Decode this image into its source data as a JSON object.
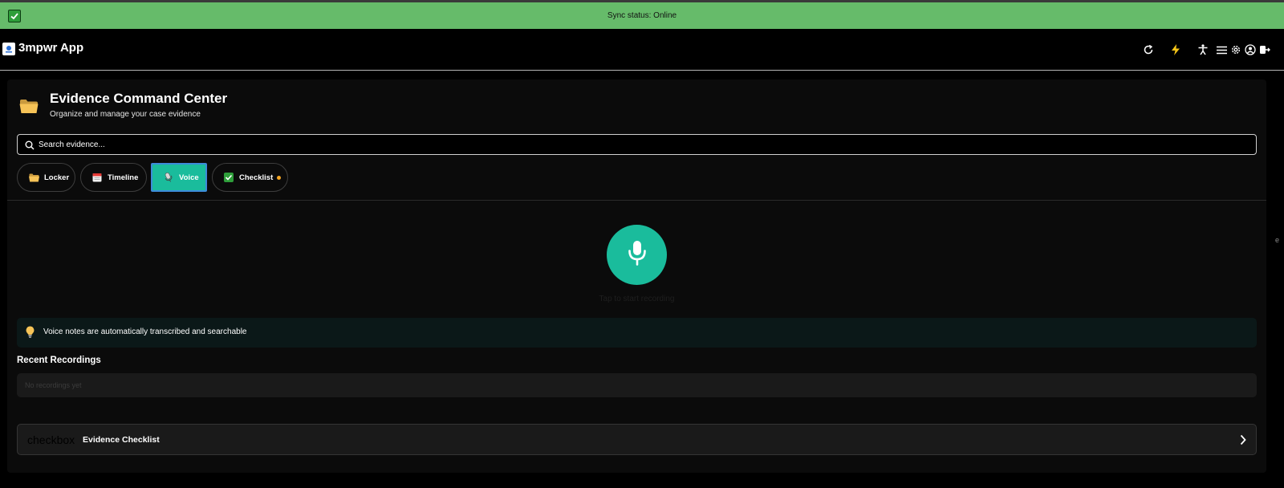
{
  "sync": {
    "status_text": "Sync status: Online"
  },
  "header": {
    "app_title": "3mpwr App",
    "icons": [
      "refresh-icon",
      "lightning-icon",
      "accessibility-icon",
      "menu-icon",
      "gear-icon",
      "user-circle-icon",
      "logout-icon"
    ]
  },
  "evidence": {
    "title": "Evidence Command Center",
    "subtitle": "Organize and manage your case evidence",
    "search": {
      "placeholder": "Search evidence..."
    },
    "tabs": [
      {
        "label": "Locker",
        "icon": "folder-icon",
        "active": false
      },
      {
        "label": "Timeline",
        "icon": "calendar-icon",
        "active": false
      },
      {
        "label": "Voice",
        "icon": "microphone-icon",
        "active": true
      },
      {
        "label": "Checklist",
        "icon": "checkbox-icon",
        "active": false,
        "notification": true
      }
    ]
  },
  "voice": {
    "record_caption": "Tap to start recording",
    "tip_text": "Voice notes are automatically transcribed and searchable",
    "recent_title": "Recent Recordings",
    "recent_empty": "No recordings yet"
  },
  "checklist_card": {
    "icon_fallback": "checkbox",
    "label": "Evidence Checklist"
  },
  "colors": {
    "sync_bar": "#66bb6a",
    "accent": "#1abc9c",
    "active_tab_border": "#3d8bd9",
    "notification_dot": "#f5a623",
    "background": "#000000",
    "panel": "#0b0b0b"
  },
  "edge_glyph": "e"
}
